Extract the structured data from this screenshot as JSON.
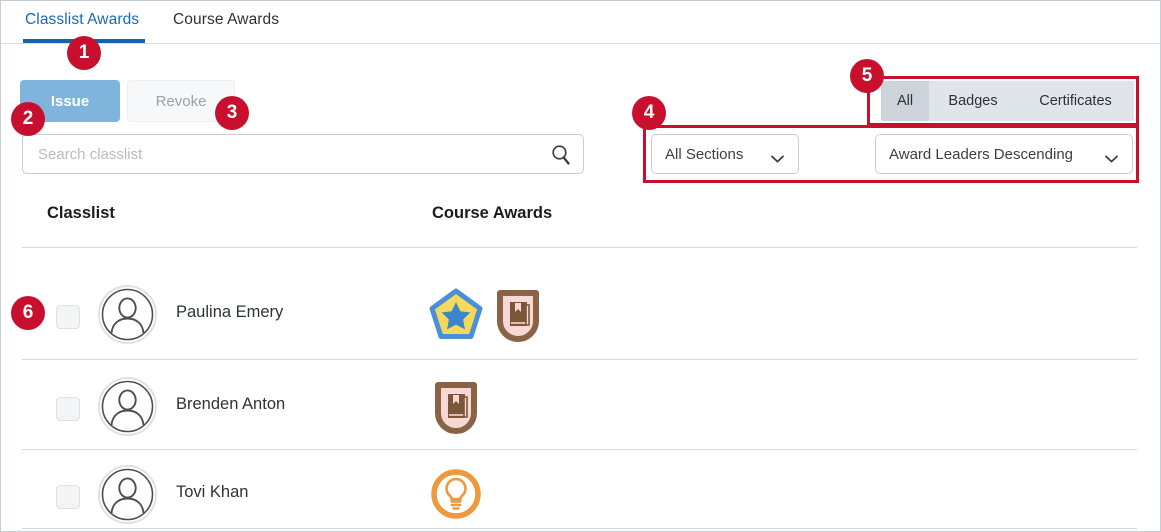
{
  "tabs": [
    {
      "label": "Classlist Awards",
      "active": true
    },
    {
      "label": "Course Awards",
      "active": false
    }
  ],
  "actions": {
    "issue_label": "Issue",
    "revoke_label": "Revoke"
  },
  "search": {
    "placeholder": "Search classlist",
    "value": "",
    "icon": "search-icon"
  },
  "award_type_filter": {
    "options": [
      "All",
      "Badges",
      "Certificates"
    ],
    "selected": "All"
  },
  "section_filter": {
    "selected": "All Sections",
    "icon": "chevron-down-icon"
  },
  "sort_filter": {
    "selected": "Award Leaders Descending",
    "icon": "chevron-down-icon"
  },
  "table": {
    "columns": [
      "Classlist",
      "Course Awards"
    ],
    "rows": [
      {
        "name": "Paulina Emery",
        "checked": false,
        "avatar_icon": "user-avatar-icon",
        "awards": [
          {
            "icon": "star-pentagon-badge-icon",
            "border": "#4a90d9",
            "fill": "#f5d95a",
            "accent": "#3d86cd"
          },
          {
            "icon": "book-shield-badge-icon",
            "border": "#8b6245",
            "fill": "#f7d8d4",
            "accent": "#7b5639"
          }
        ]
      },
      {
        "name": "Brenden Anton",
        "checked": false,
        "avatar_icon": "user-avatar-icon",
        "awards": [
          {
            "icon": "book-shield-badge-icon",
            "border": "#8b6245",
            "fill": "#f7d8d4",
            "accent": "#7b5639"
          }
        ]
      },
      {
        "name": "Tovi Khan",
        "checked": false,
        "avatar_icon": "user-avatar-icon",
        "awards": [
          {
            "icon": "lightbulb-circle-badge-icon",
            "border": "#ed9a3c",
            "fill": "#ffffff",
            "accent": "#ed9a3c"
          }
        ]
      }
    ]
  },
  "callouts": [
    {
      "number": "1"
    },
    {
      "number": "2"
    },
    {
      "number": "3"
    },
    {
      "number": "4"
    },
    {
      "number": "5"
    },
    {
      "number": "6"
    }
  ],
  "colors": {
    "accent_blue": "#1463ac",
    "issue_blue": "#7fb5dd",
    "callout_red": "#c8102e",
    "toggle_bg": "#dfe5ea",
    "toggle_selected_bg": "#ccd3db"
  }
}
